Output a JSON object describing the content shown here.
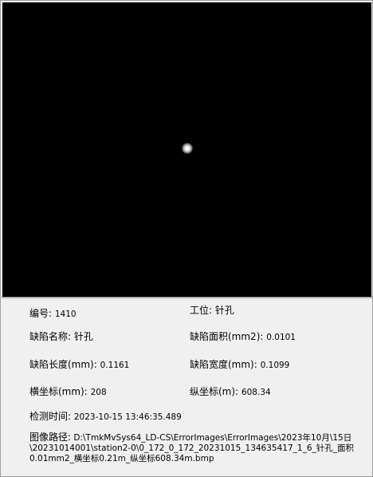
{
  "info": {
    "id_label": "编号:",
    "id_value": "1410",
    "station_label": "工位:",
    "station_value": "针孔",
    "defect_name_label": "缺陷名称:",
    "defect_name_value": "针孔",
    "defect_area_label": "缺陷面积(mm2):",
    "defect_area_value": "0.0101",
    "defect_length_label": "缺陷长度(mm):",
    "defect_length_value": "0.1161",
    "defect_width_label": "缺陷宽度(mm):",
    "defect_width_value": "0.1099",
    "x_coord_label": "横坐标(mm):",
    "x_coord_value": "208",
    "y_coord_label": "纵坐标(m):",
    "y_coord_value": "608.34",
    "detect_time_label": "检测时间:",
    "detect_time_value": "2023-10-15 13:46:35.489",
    "image_path_label": "图像路径:",
    "image_path_line1": "D:\\TmkMvSys64_LD-CS\\ErrorImages\\ErrorImages\\2023年10月\\15日",
    "image_path_line2": "\\20231014001\\station2-0\\0_172_0_172_20231015_134635417_1_6_针孔_面积",
    "image_path_line3": "0.01mm2_横坐标0.21m_纵坐标608.34m.bmp"
  }
}
